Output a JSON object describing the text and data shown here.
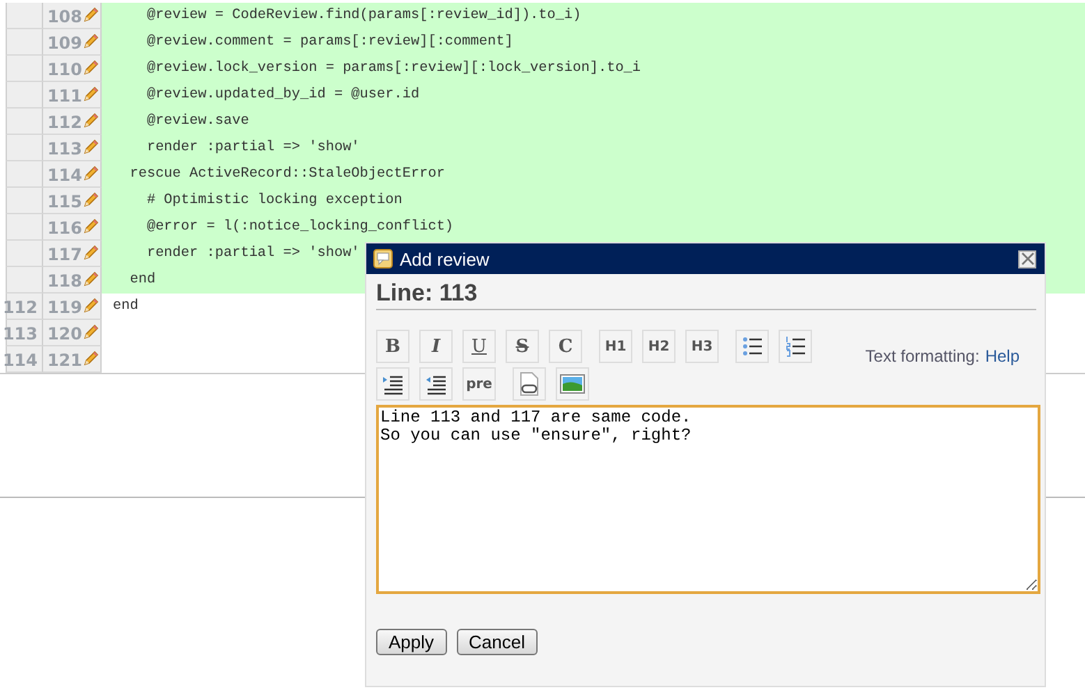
{
  "code_rows": [
    {
      "old_line": "",
      "new_line": "108",
      "added": true,
      "code": "    @review = CodeReview.find(params[:review_id]).to_i)"
    },
    {
      "old_line": "",
      "new_line": "109",
      "added": true,
      "code": "    @review.comment = params[:review][:comment]"
    },
    {
      "old_line": "",
      "new_line": "110",
      "added": true,
      "code": "    @review.lock_version = params[:review][:lock_version].to_i"
    },
    {
      "old_line": "",
      "new_line": "111",
      "added": true,
      "code": "    @review.updated_by_id = @user.id"
    },
    {
      "old_line": "",
      "new_line": "112",
      "added": true,
      "code": "    @review.save"
    },
    {
      "old_line": "",
      "new_line": "113",
      "added": true,
      "code": "    render :partial => 'show'"
    },
    {
      "old_line": "",
      "new_line": "114",
      "added": true,
      "code": "  rescue ActiveRecord::StaleObjectError"
    },
    {
      "old_line": "",
      "new_line": "115",
      "added": true,
      "code": "    # Optimistic locking exception"
    },
    {
      "old_line": "",
      "new_line": "116",
      "added": true,
      "code": "    @error = l(:notice_locking_conflict)"
    },
    {
      "old_line": "",
      "new_line": "117",
      "added": true,
      "code": "    render :partial => 'show'"
    },
    {
      "old_line": "",
      "new_line": "118",
      "added": true,
      "code": "  end"
    },
    {
      "old_line": "112",
      "new_line": "119",
      "added": false,
      "code": "end"
    },
    {
      "old_line": "113",
      "new_line": "120",
      "added": false,
      "code": ""
    },
    {
      "old_line": "114",
      "new_line": "121",
      "added": false,
      "code": ""
    }
  ],
  "dialog": {
    "title": "Add review",
    "heading": "Line: 113",
    "toolbar": [
      {
        "kind": "text",
        "label": "B"
      },
      {
        "kind": "text",
        "label": "I"
      },
      {
        "kind": "text",
        "label": "U"
      },
      {
        "kind": "text",
        "label": "S"
      },
      {
        "kind": "text",
        "label": "C"
      },
      {
        "kind": "text",
        "label": "H1"
      },
      {
        "kind": "text",
        "label": "H2"
      },
      {
        "kind": "text",
        "label": "H3"
      },
      {
        "kind": "bullet-list"
      },
      {
        "kind": "numbered-list"
      },
      {
        "kind": "indent"
      },
      {
        "kind": "outdent"
      },
      {
        "kind": "text",
        "label": "pre"
      },
      {
        "kind": "link"
      },
      {
        "kind": "image"
      }
    ],
    "help_label": "Text formatting:",
    "help_link": "Help",
    "comment": "Line 113 and 117 are same code.\nSo you can use ″ensure″, right?",
    "buttons": [
      "Apply",
      "Cancel"
    ]
  }
}
